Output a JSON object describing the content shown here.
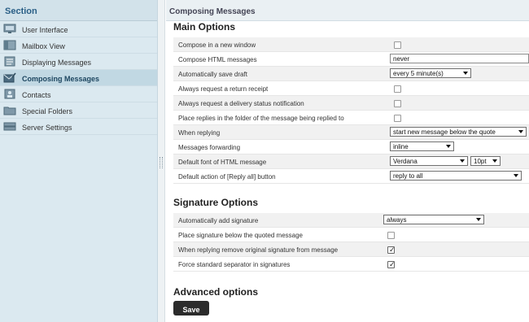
{
  "sidebar": {
    "header": "Section",
    "items": [
      {
        "label": "User Interface",
        "icon": "monitor-icon",
        "active": false
      },
      {
        "label": "Mailbox View",
        "icon": "mailbox-view-icon",
        "active": false
      },
      {
        "label": "Displaying Messages",
        "icon": "display-messages-icon",
        "active": false
      },
      {
        "label": "Composing Messages",
        "icon": "compose-envelope-icon",
        "active": true
      },
      {
        "label": "Contacts",
        "icon": "contacts-icon",
        "active": false
      },
      {
        "label": "Special Folders",
        "icon": "folder-icon",
        "active": false
      },
      {
        "label": "Server Settings",
        "icon": "server-icon",
        "active": false
      }
    ]
  },
  "main": {
    "header": "Composing Messages",
    "main_options": {
      "title": "Main Options",
      "rows": [
        {
          "label": "Compose in a new window",
          "type": "checkbox",
          "checked": false
        },
        {
          "label": "Compose HTML messages",
          "type": "text",
          "value": "never"
        },
        {
          "label": "Automatically save draft",
          "type": "select",
          "value": "every 5 minute(s)"
        },
        {
          "label": "Always request a return receipt",
          "type": "checkbox",
          "checked": false
        },
        {
          "label": "Always request a delivery status notification",
          "type": "checkbox",
          "checked": false
        },
        {
          "label": "Place replies in the folder of the message being replied to",
          "type": "checkbox",
          "checked": false
        },
        {
          "label": "When replying",
          "type": "select",
          "value": "start new message below the quote"
        },
        {
          "label": "Messages forwarding",
          "type": "select",
          "value": "inline"
        },
        {
          "label": "Default font of HTML message",
          "type": "font",
          "value": "Verdana",
          "size": "10pt"
        },
        {
          "label": "Default action of [Reply all] button",
          "type": "select",
          "value": "reply to all"
        }
      ]
    },
    "signature_options": {
      "title": "Signature Options",
      "rows": [
        {
          "label": "Automatically add signature",
          "type": "select",
          "value": "always"
        },
        {
          "label": "Place signature below the quoted message",
          "type": "checkbox",
          "checked": false
        },
        {
          "label": "When replying remove original signature from message",
          "type": "checkbox",
          "checked": true
        },
        {
          "label": "Force standard separator in signatures",
          "type": "checkbox",
          "checked": true
        }
      ]
    },
    "advanced_options": {
      "title": "Advanced options"
    },
    "save_label": "Save"
  }
}
